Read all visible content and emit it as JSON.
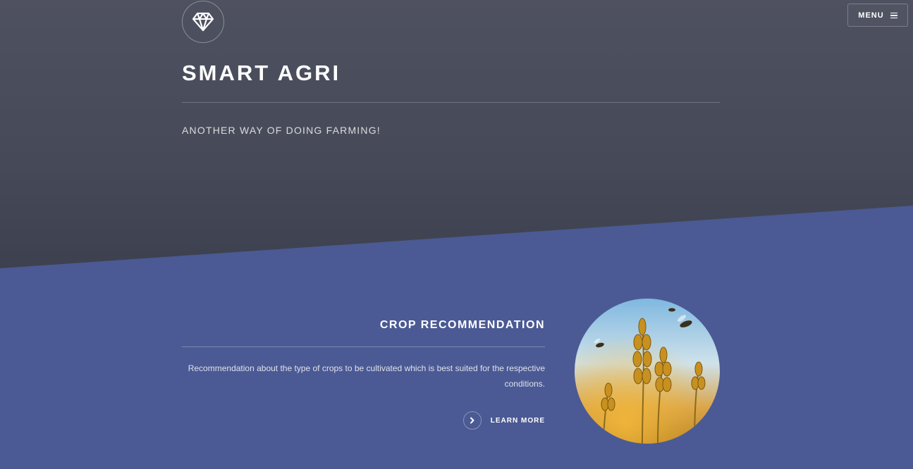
{
  "header": {
    "logo_icon": "diamond-icon",
    "menu_label": "MENU",
    "menu_icon": "hamburger-icon",
    "title": "SMART AGRI",
    "tagline": "ANOTHER WAY OF DOING FARMING!"
  },
  "feature": {
    "title": "CROP RECOMMENDATION",
    "description": "Recommendation about the type of crops to be cultivated which is best suited for the respective conditions.",
    "cta_label": "LEARN MORE",
    "cta_icon": "chevron-right-icon",
    "image": "wheat-field-with-bees"
  },
  "colors": {
    "header_bg": "#464a58",
    "section_bg": "#4b5a94",
    "text": "#ffffff"
  }
}
